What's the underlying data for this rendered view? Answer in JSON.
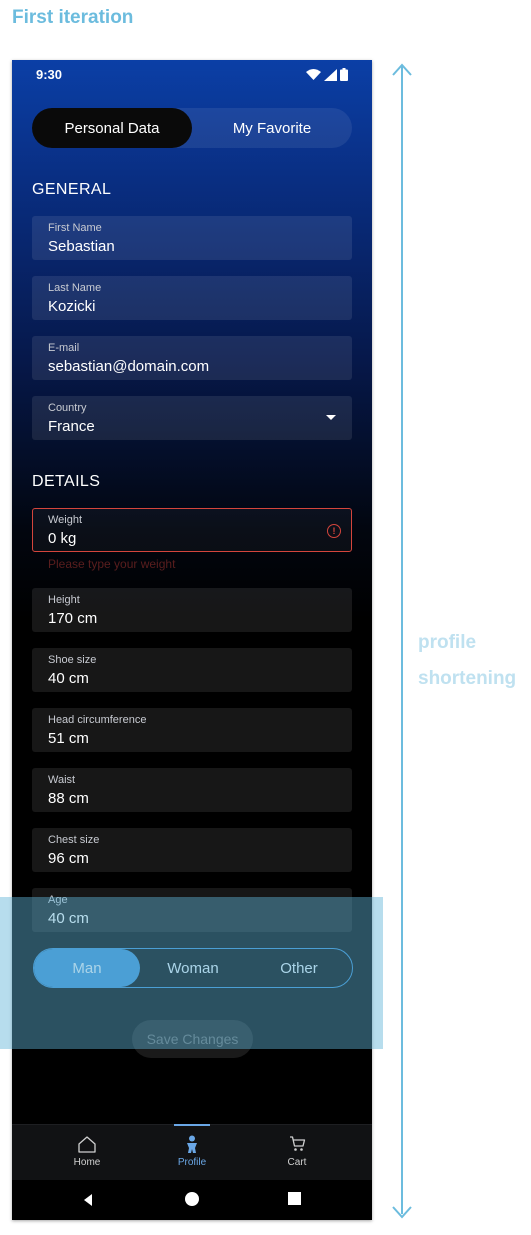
{
  "canvas": {
    "title": "First iteration",
    "annotation_line1": "profile",
    "annotation_line2": "shortening",
    "annotation_color": "#6cbcde"
  },
  "status_bar": {
    "time": "9:30",
    "icons": [
      "wifi-icon",
      "signal-icon",
      "battery-icon"
    ]
  },
  "tabs": [
    {
      "label": "Personal Data",
      "active": true
    },
    {
      "label": "My Favorite",
      "active": false
    }
  ],
  "sections": {
    "general": "GENERAL",
    "details": "DETAILS"
  },
  "general_fields": [
    {
      "label": "First Name",
      "value": "Sebastian"
    },
    {
      "label": "Last Name",
      "value": "Kozicki"
    },
    {
      "label": "E-mail",
      "value": "sebastian@domain.com"
    },
    {
      "label": "Country",
      "value": "France",
      "type": "dropdown"
    }
  ],
  "detail_fields": [
    {
      "label": "Weight",
      "value": "0 kg",
      "error": true,
      "helper": "Please type your weight"
    },
    {
      "label": "Height",
      "value": "170 cm"
    },
    {
      "label": "Shoe size",
      "value": "40 cm"
    },
    {
      "label": "Head circumference",
      "value": "51 cm"
    },
    {
      "label": "Waist",
      "value": "88 cm"
    },
    {
      "label": "Chest size",
      "value": "96 cm"
    },
    {
      "label": "Age",
      "value": "40 cm"
    }
  ],
  "gender": {
    "options": [
      "Man",
      "Woman",
      "Other"
    ],
    "selected": "Man",
    "accent": "#3b8ed4"
  },
  "save_button": {
    "label": "Save Changes"
  },
  "bottom_nav": [
    {
      "label": "Home",
      "icon": "home-icon",
      "active": false
    },
    {
      "label": "Profile",
      "icon": "person-icon",
      "active": true
    },
    {
      "label": "Cart",
      "icon": "cart-icon",
      "active": false
    }
  ],
  "system_nav": [
    "back-icon",
    "home-circle-icon",
    "recents-icon"
  ]
}
